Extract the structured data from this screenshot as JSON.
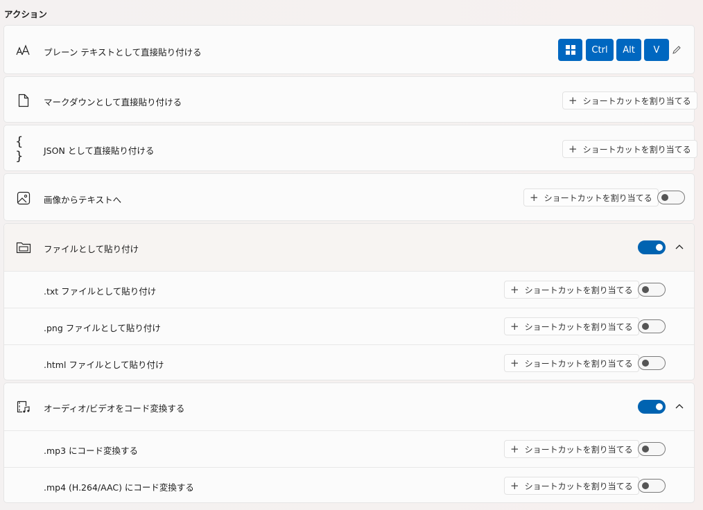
{
  "section": {
    "title": "アクション"
  },
  "actions": {
    "plain_text": {
      "label": "プレーン テキストとして直接貼り付ける",
      "icon": "font-size-icon",
      "keys": [
        "Ctrl",
        "Alt",
        "V"
      ],
      "key_windows_icon": "windows-logo-icon",
      "edit_icon": "pencil-icon"
    },
    "markdown": {
      "label": "マークダウンとして直接貼り付ける",
      "icon": "document-icon",
      "shortcut_label": "ショートカットを割り当てる"
    },
    "json": {
      "label": "JSON として直接貼り付ける",
      "icon": "braces-icon",
      "shortcut_label": "ショートカットを割り当てる"
    },
    "image_to_text": {
      "label": "画像からテキストへ",
      "icon": "image-icon",
      "shortcut_label": "ショートカットを割り当てる",
      "enabled": false
    },
    "paste_as_file": {
      "label": "ファイルとして貼り付け",
      "icon": "folder-icon",
      "enabled": true,
      "expanded": true,
      "children": [
        {
          "label": ".txt ファイルとして貼り付け",
          "shortcut_label": "ショートカットを割り当てる",
          "enabled": false
        },
        {
          "label": ".png ファイルとして貼り付け",
          "shortcut_label": "ショートカットを割り当てる",
          "enabled": false
        },
        {
          "label": ".html ファイルとして貼り付け",
          "shortcut_label": "ショートカットを割り当てる",
          "enabled": false
        }
      ]
    },
    "transcode": {
      "label": "オーディオ/ビデオをコード変換する",
      "icon": "media-file-icon",
      "enabled": true,
      "expanded": true,
      "children": [
        {
          "label": ".mp3 にコード変換する",
          "shortcut_label": "ショートカットを割り当てる",
          "enabled": false
        },
        {
          "label": ".mp4 (H.264/AAC) にコード変換する",
          "shortcut_label": "ショートカットを割り当てる",
          "enabled": false
        }
      ]
    }
  },
  "colors": {
    "accent": "#0067c0",
    "toggle_on": "#0063b1"
  }
}
